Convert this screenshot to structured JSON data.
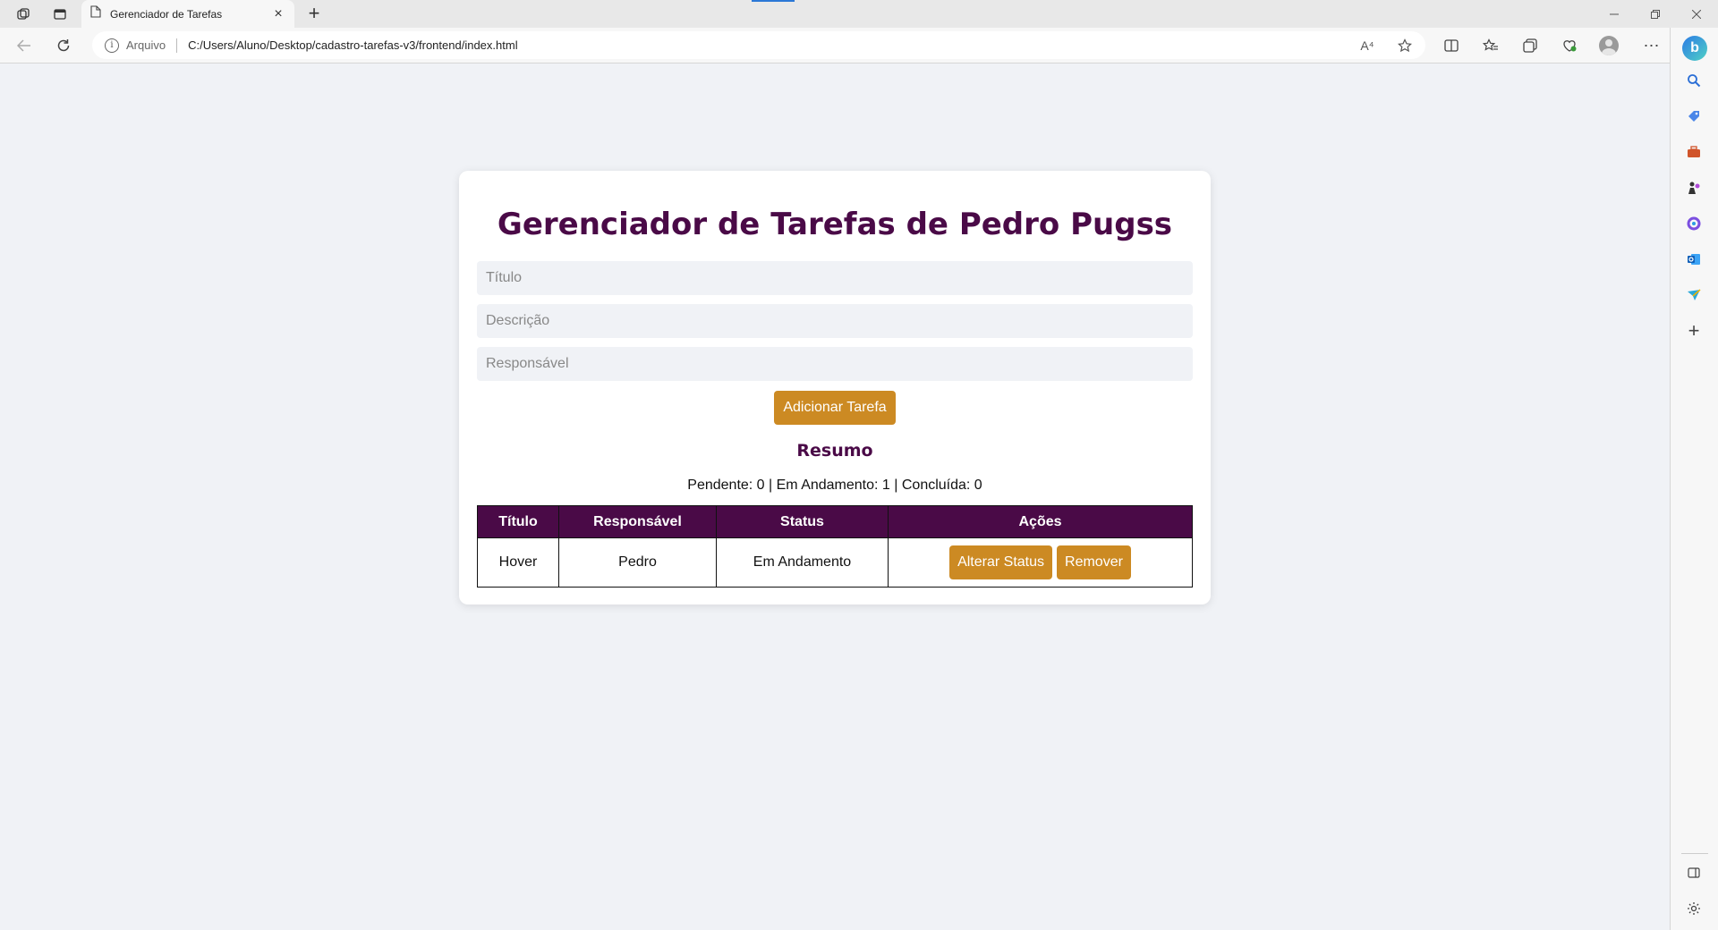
{
  "browser": {
    "tab_title": "Gerenciador de Tarefas",
    "tab_close": "×",
    "new_tab": "+",
    "address_label": "Arquivo",
    "address_url": "C:/Users/Aluno/Desktop/cadastro-tarefas-v3/frontend/index.html",
    "read_aloud": "A⁴"
  },
  "page": {
    "title": "Gerenciador de Tarefas de Pedro Pugss",
    "form": {
      "title_placeholder": "Título",
      "description_placeholder": "Descrição",
      "responsible_placeholder": "Responsável",
      "title_value": "",
      "description_value": "",
      "responsible_value": "",
      "add_button": "Adicionar Tarefa"
    },
    "summary": {
      "heading": "Resumo",
      "text": "Pendente: 0 | Em Andamento: 1 | Concluída: 0"
    },
    "table": {
      "headers": [
        "Título",
        "Responsável",
        "Status",
        "Ações"
      ],
      "rows": [
        {
          "title": "Hover",
          "responsible": "Pedro",
          "status": "Em Andamento",
          "change_status": "Alterar Status",
          "remove": "Remover"
        }
      ]
    }
  },
  "colors": {
    "accent_purple": "#4a0a47",
    "button_gold": "#cc8a23",
    "background": "#f0f2f6"
  }
}
